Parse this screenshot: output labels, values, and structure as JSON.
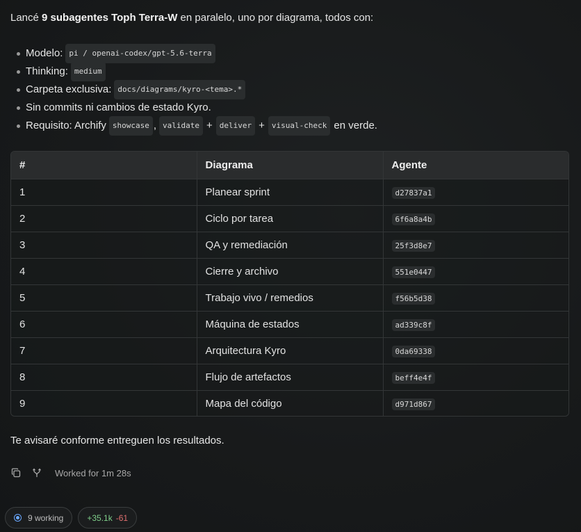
{
  "intro": {
    "prefix": "Lancé",
    "bold": "9 subagentes Toph Terra-W",
    "suffix": "en paralelo, uno por diagrama, todos con:"
  },
  "bullets": {
    "model_label": "Modelo:",
    "model_value": "pi / openai-codex/gpt-5.6-terra",
    "thinking_label": "Thinking:",
    "thinking_value": "medium",
    "folder_label": "Carpeta exclusiva:",
    "folder_value": "docs/diagrams/kyro-<tema>.*",
    "no_commits": "Sin commits ni cambios de estado Kyro.",
    "req_label": "Requisito: Archify",
    "req_showcase": "showcase",
    "req_comma": ",",
    "req_validate": "validate",
    "req_plus1": "+",
    "req_deliver": "deliver",
    "req_plus2": "+",
    "req_visual": "visual-check",
    "req_suffix": "en verde."
  },
  "table": {
    "headers": [
      "#",
      "Diagrama",
      "Agente"
    ],
    "rows": [
      [
        "1",
        "Planear sprint",
        "d27837a1"
      ],
      [
        "2",
        "Ciclo por tarea",
        "6f6a8a4b"
      ],
      [
        "3",
        "QA y remediación",
        "25f3d8e7"
      ],
      [
        "4",
        "Cierre y archivo",
        "551e0447"
      ],
      [
        "5",
        "Trabajo vivo / remedios",
        "f56b5d38"
      ],
      [
        "6",
        "Máquina de estados",
        "ad339c8f"
      ],
      [
        "7",
        "Arquitectura Kyro",
        "0da69338"
      ],
      [
        "8",
        "Flujo de artefactos",
        "beff4e4f"
      ],
      [
        "9",
        "Mapa del código",
        "d971d867"
      ]
    ]
  },
  "closing": "Te avisaré conforme entreguen los resultados.",
  "meta": {
    "worked": "Worked for 1m 28s",
    "copy_icon": "copy-icon",
    "branch_icon": "fork-icon"
  },
  "status": {
    "working": "9 working",
    "additions": "+35.1k",
    "deletions": "-61"
  },
  "colors": {
    "accent": "#6aa8ff",
    "additions": "#7fcf8a",
    "deletions": "#e07070"
  }
}
